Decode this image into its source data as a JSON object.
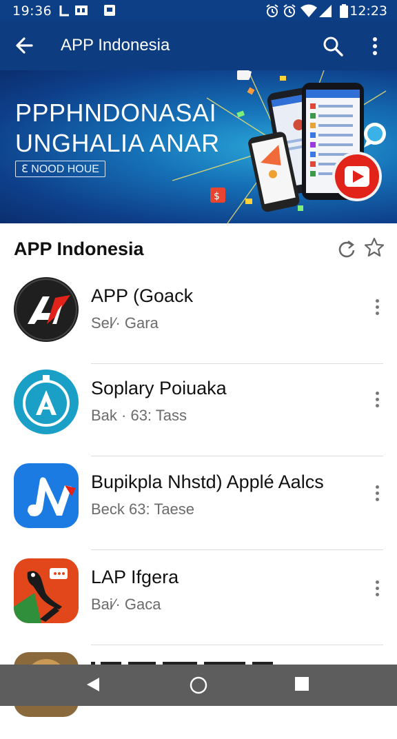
{
  "status_bar": {
    "time_left": "19:36",
    "time_right": "12:23",
    "icons": [
      "carrier-icon",
      "notification-icon",
      "photo-icon",
      "alarm-icon",
      "alarm-icon",
      "wifi-icon",
      "signal-icon",
      "battery-icon"
    ]
  },
  "app_bar": {
    "title": "APP Indonesia",
    "icons": [
      "back-arrow-icon",
      "search-icon",
      "more-vert-icon"
    ]
  },
  "banner": {
    "headline_line1": "PPPHNDONASAI",
    "headline_line2": "UNGHALIA ANAR",
    "tag": "ℇ NOOD HOUE"
  },
  "section": {
    "title": "APP Indonesia",
    "icons": [
      "refresh-icon",
      "star-icon"
    ]
  },
  "apps": [
    {
      "name": "APP (Goack",
      "subtitle": "Sel⁄· Gara",
      "icon_color": "#1f1f1f"
    },
    {
      "name": "Soplary Poiuaka",
      "subtitle": "Bak · 63: Tass",
      "icon_color": "#1aa0c6"
    },
    {
      "name": "Bupikpla Nhstd) Applé Aalcs",
      "subtitle": "Beck 63: Taese",
      "icon_color": "#1b7be3"
    },
    {
      "name": "LAP Ifgera",
      "subtitle": "Bai⁄· Gaca",
      "icon_color": "#e2471b"
    }
  ],
  "nav_bar": {
    "icons": [
      "back-triangle-icon",
      "home-circle-icon",
      "recents-square-icon"
    ]
  },
  "colors": {
    "app_bar": "#0d3c80",
    "nav_bar": "#5d5d5d"
  }
}
